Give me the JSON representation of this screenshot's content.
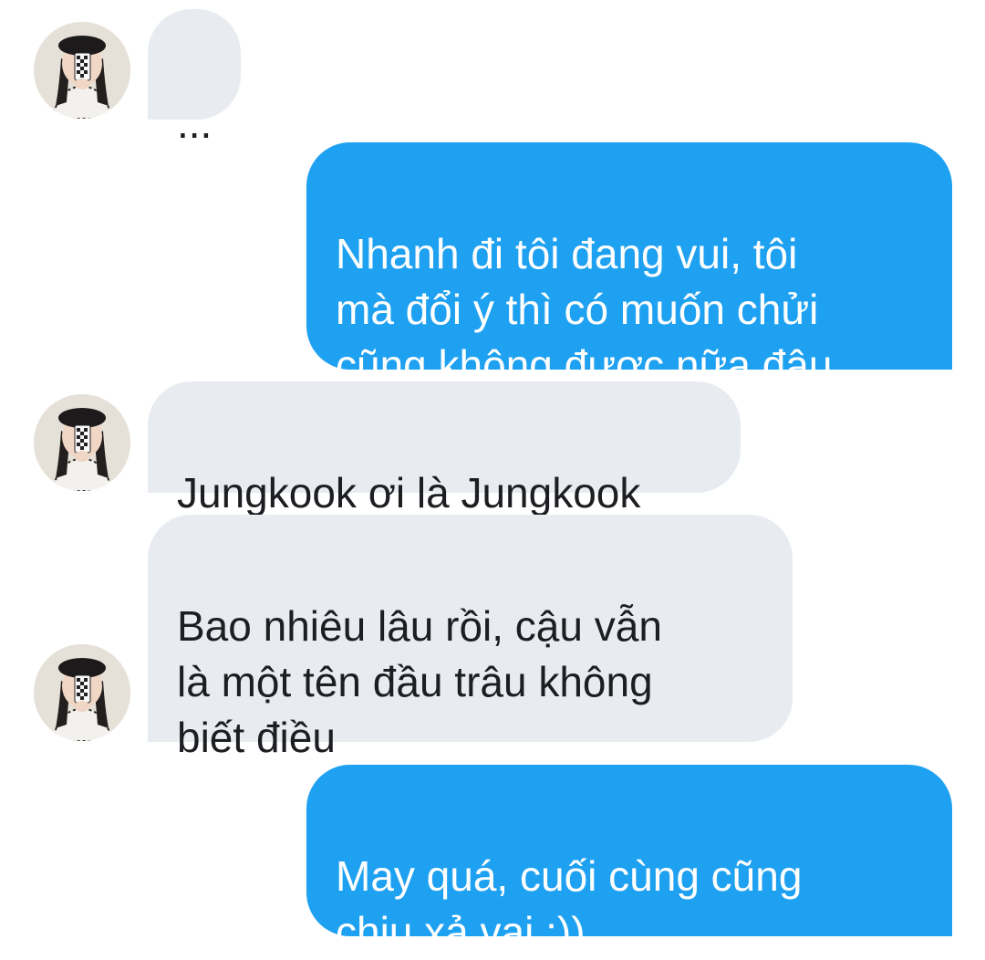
{
  "chat": {
    "messages": [
      {
        "side": "incoming",
        "text": "..."
      },
      {
        "side": "outgoing",
        "text": "Nhanh đi tôi đang vui, tôi\nmà đổi ý thì có muốn chửi\ncũng không được nữa đâu"
      },
      {
        "side": "incoming",
        "text": "Jungkook ơi là Jungkook"
      },
      {
        "side": "incoming",
        "text": "Bao nhiêu lâu rồi, cậu vẫn\nlà một tên đầu trâu không\nbiết điều"
      },
      {
        "side": "outgoing",
        "text": "May quá, cuối cùng cũng\nchịu xả vai :))"
      }
    ]
  },
  "colors": {
    "outgoing_bubble": "#1fa1f1",
    "incoming_bubble": "#e8ecf0",
    "incoming_text": "#1c1e21",
    "outgoing_text": "#ffffff"
  }
}
